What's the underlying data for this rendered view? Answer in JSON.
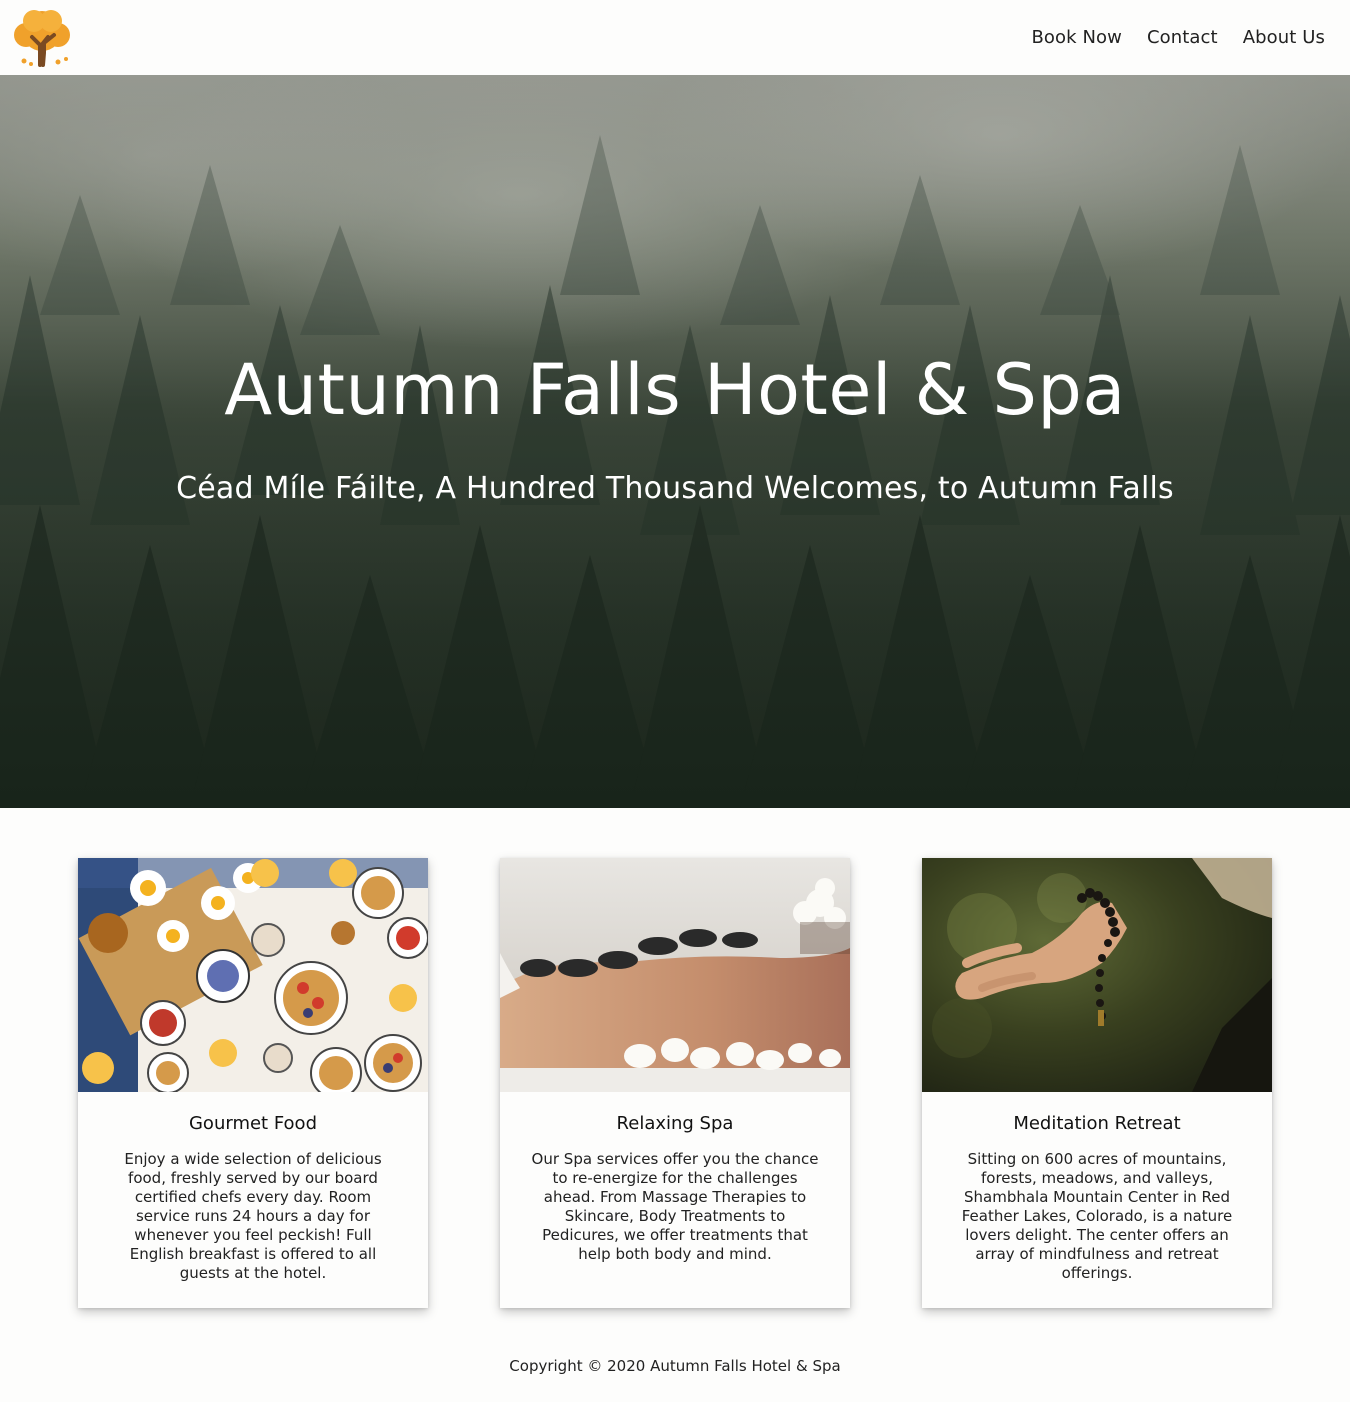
{
  "header": {
    "logo_icon": "autumn-tree-icon",
    "nav": [
      {
        "label": "Book Now"
      },
      {
        "label": "Contact"
      },
      {
        "label": "About Us"
      }
    ]
  },
  "hero": {
    "title": "Autumn Falls Hotel & Spa",
    "subtitle": "Céad Míle Fáilte, A Hundred Thousand Welcomes, to Autumn Falls"
  },
  "cards": [
    {
      "title": "Gourmet Food",
      "text": "Enjoy a wide selection of delicious food, freshly served by our board certified chefs every day. Room service runs 24 hours a day for whenever you feel peckish! Full English breakfast is offered to all guests at the hotel."
    },
    {
      "title": "Relaxing Spa",
      "text": "Our Spa services offer you the chance to re-energize for the challenges ahead. From Massage Therapies to Skincare, Body Treatments to Pedicures, we offer treatments that help both body and mind."
    },
    {
      "title": "Meditation Retreat",
      "text": "Sitting on 600 acres of mountains, forests, meadows, and valleys, Shambhala Mountain Center in Red Feather Lakes, Colorado, is a nature lovers delight. The center offers an array of mindfulness and retreat offerings."
    }
  ],
  "footer": {
    "copyright": "Copyright © 2020 Autumn Falls Hotel & Spa"
  },
  "colors": {
    "logo_orange": "#f0a12b",
    "page_background": "#fdfdfc"
  }
}
